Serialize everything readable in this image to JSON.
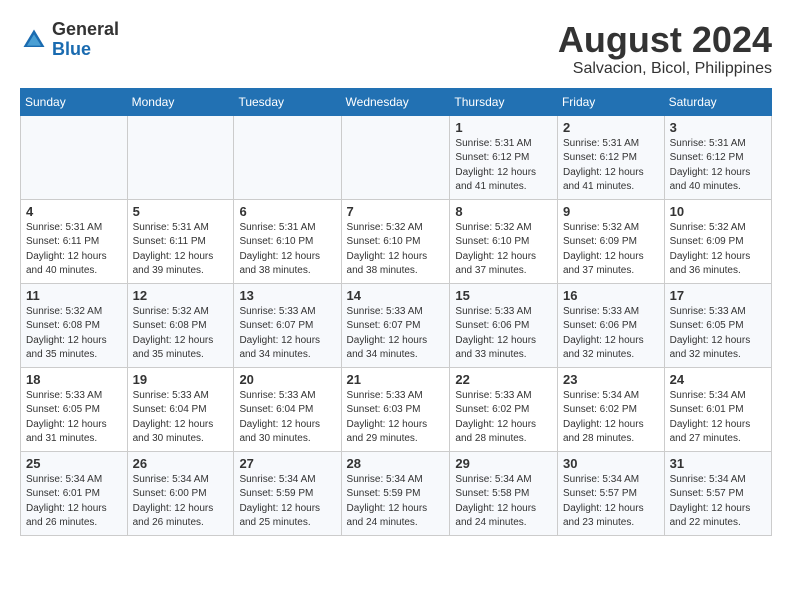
{
  "header": {
    "logo": {
      "general": "General",
      "blue": "Blue"
    },
    "title": "August 2024",
    "subtitle": "Salvacion, Bicol, Philippines"
  },
  "days_of_week": [
    "Sunday",
    "Monday",
    "Tuesday",
    "Wednesday",
    "Thursday",
    "Friday",
    "Saturday"
  ],
  "weeks": [
    [
      {
        "day": "",
        "info": ""
      },
      {
        "day": "",
        "info": ""
      },
      {
        "day": "",
        "info": ""
      },
      {
        "day": "",
        "info": ""
      },
      {
        "day": "1",
        "info": "Sunrise: 5:31 AM\nSunset: 6:12 PM\nDaylight: 12 hours\nand 41 minutes."
      },
      {
        "day": "2",
        "info": "Sunrise: 5:31 AM\nSunset: 6:12 PM\nDaylight: 12 hours\nand 41 minutes."
      },
      {
        "day": "3",
        "info": "Sunrise: 5:31 AM\nSunset: 6:12 PM\nDaylight: 12 hours\nand 40 minutes."
      }
    ],
    [
      {
        "day": "4",
        "info": "Sunrise: 5:31 AM\nSunset: 6:11 PM\nDaylight: 12 hours\nand 40 minutes."
      },
      {
        "day": "5",
        "info": "Sunrise: 5:31 AM\nSunset: 6:11 PM\nDaylight: 12 hours\nand 39 minutes."
      },
      {
        "day": "6",
        "info": "Sunrise: 5:31 AM\nSunset: 6:10 PM\nDaylight: 12 hours\nand 38 minutes."
      },
      {
        "day": "7",
        "info": "Sunrise: 5:32 AM\nSunset: 6:10 PM\nDaylight: 12 hours\nand 38 minutes."
      },
      {
        "day": "8",
        "info": "Sunrise: 5:32 AM\nSunset: 6:10 PM\nDaylight: 12 hours\nand 37 minutes."
      },
      {
        "day": "9",
        "info": "Sunrise: 5:32 AM\nSunset: 6:09 PM\nDaylight: 12 hours\nand 37 minutes."
      },
      {
        "day": "10",
        "info": "Sunrise: 5:32 AM\nSunset: 6:09 PM\nDaylight: 12 hours\nand 36 minutes."
      }
    ],
    [
      {
        "day": "11",
        "info": "Sunrise: 5:32 AM\nSunset: 6:08 PM\nDaylight: 12 hours\nand 35 minutes."
      },
      {
        "day": "12",
        "info": "Sunrise: 5:32 AM\nSunset: 6:08 PM\nDaylight: 12 hours\nand 35 minutes."
      },
      {
        "day": "13",
        "info": "Sunrise: 5:33 AM\nSunset: 6:07 PM\nDaylight: 12 hours\nand 34 minutes."
      },
      {
        "day": "14",
        "info": "Sunrise: 5:33 AM\nSunset: 6:07 PM\nDaylight: 12 hours\nand 34 minutes."
      },
      {
        "day": "15",
        "info": "Sunrise: 5:33 AM\nSunset: 6:06 PM\nDaylight: 12 hours\nand 33 minutes."
      },
      {
        "day": "16",
        "info": "Sunrise: 5:33 AM\nSunset: 6:06 PM\nDaylight: 12 hours\nand 32 minutes."
      },
      {
        "day": "17",
        "info": "Sunrise: 5:33 AM\nSunset: 6:05 PM\nDaylight: 12 hours\nand 32 minutes."
      }
    ],
    [
      {
        "day": "18",
        "info": "Sunrise: 5:33 AM\nSunset: 6:05 PM\nDaylight: 12 hours\nand 31 minutes."
      },
      {
        "day": "19",
        "info": "Sunrise: 5:33 AM\nSunset: 6:04 PM\nDaylight: 12 hours\nand 30 minutes."
      },
      {
        "day": "20",
        "info": "Sunrise: 5:33 AM\nSunset: 6:04 PM\nDaylight: 12 hours\nand 30 minutes."
      },
      {
        "day": "21",
        "info": "Sunrise: 5:33 AM\nSunset: 6:03 PM\nDaylight: 12 hours\nand 29 minutes."
      },
      {
        "day": "22",
        "info": "Sunrise: 5:33 AM\nSunset: 6:02 PM\nDaylight: 12 hours\nand 28 minutes."
      },
      {
        "day": "23",
        "info": "Sunrise: 5:34 AM\nSunset: 6:02 PM\nDaylight: 12 hours\nand 28 minutes."
      },
      {
        "day": "24",
        "info": "Sunrise: 5:34 AM\nSunset: 6:01 PM\nDaylight: 12 hours\nand 27 minutes."
      }
    ],
    [
      {
        "day": "25",
        "info": "Sunrise: 5:34 AM\nSunset: 6:01 PM\nDaylight: 12 hours\nand 26 minutes."
      },
      {
        "day": "26",
        "info": "Sunrise: 5:34 AM\nSunset: 6:00 PM\nDaylight: 12 hours\nand 26 minutes."
      },
      {
        "day": "27",
        "info": "Sunrise: 5:34 AM\nSunset: 5:59 PM\nDaylight: 12 hours\nand 25 minutes."
      },
      {
        "day": "28",
        "info": "Sunrise: 5:34 AM\nSunset: 5:59 PM\nDaylight: 12 hours\nand 24 minutes."
      },
      {
        "day": "29",
        "info": "Sunrise: 5:34 AM\nSunset: 5:58 PM\nDaylight: 12 hours\nand 24 minutes."
      },
      {
        "day": "30",
        "info": "Sunrise: 5:34 AM\nSunset: 5:57 PM\nDaylight: 12 hours\nand 23 minutes."
      },
      {
        "day": "31",
        "info": "Sunrise: 5:34 AM\nSunset: 5:57 PM\nDaylight: 12 hours\nand 22 minutes."
      }
    ]
  ]
}
